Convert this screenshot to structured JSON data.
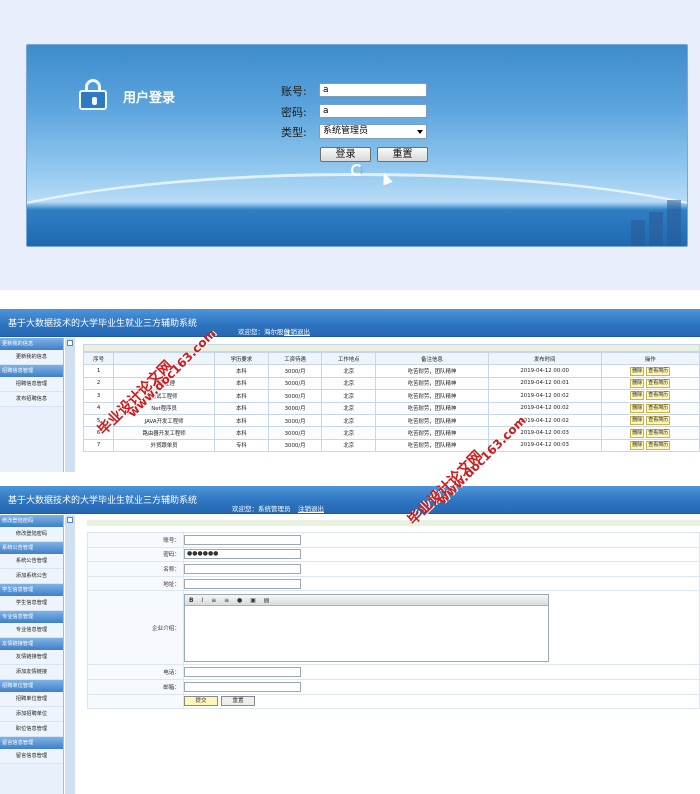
{
  "login": {
    "title": "用户登录",
    "account_label": "账号:",
    "account_value": "a",
    "password_label": "密码:",
    "password_value": "a",
    "type_label": "类型:",
    "type_value": "系统管理员",
    "login_button": "登录",
    "reset_button": "重置"
  },
  "app": {
    "title": "基于大数据技术的大学毕业生就业三方辅助系统",
    "welcome": "欢迎您：系统管理员",
    "welcome_partial": "欢迎您：海尔股份",
    "logout": "注销退出"
  },
  "company_view": {
    "sidebar": [
      {
        "type": "group",
        "label": "更新我的信息"
      },
      {
        "type": "item",
        "label": "更新我的信息"
      },
      {
        "type": "group",
        "label": "招聘信息管理"
      },
      {
        "type": "item",
        "label": "招聘信息管理"
      },
      {
        "type": "item",
        "label": "发布招聘信息"
      }
    ],
    "table": {
      "headers": [
        "序号",
        "",
        "学历要求",
        "工资待遇",
        "工作地点",
        "备注信息",
        "发布时间",
        "操作"
      ],
      "rows": [
        [
          "1",
          "",
          "本科",
          "3000/月",
          "北京",
          "吃苦耐劳，团队精神",
          "2019-04-12 00:00"
        ],
        [
          "2",
          "项目经理",
          "本科",
          "3000/月",
          "北京",
          "吃苦耐劳，团队精神",
          "2019-04-12 00:01"
        ],
        [
          "3",
          "测试工程师",
          "本科",
          "3000/月",
          "北京",
          "吃苦耐劳，团队精神",
          "2019-04-12 00:02"
        ],
        [
          "4",
          "Net程序员",
          "本科",
          "3000/月",
          "北京",
          "吃苦耐劳，团队精神",
          "2019-04-12 00:02"
        ],
        [
          "5",
          "JAVA开发工程师",
          "本科",
          "3000/月",
          "北京",
          "吃苦耐劳，团队精神",
          "2019-04-12 00:02"
        ],
        [
          "6",
          "路由器开发工程师",
          "本科",
          "3000/月",
          "北京",
          "吃苦耐劳，团队精神",
          "2019-04-12 00:03"
        ],
        [
          "7",
          "外贸跟单员",
          "专科",
          "3000/月",
          "北京",
          "吃苦耐劳，团队精神",
          "2019-04-12 00:03"
        ]
      ],
      "delete_label": "删除",
      "resume_label": "查看简历"
    }
  },
  "admin_view": {
    "sidebar": [
      {
        "type": "group",
        "label": "修改登陆密码"
      },
      {
        "type": "item",
        "label": "修改登陆密码"
      },
      {
        "type": "group",
        "label": "系统公告管理"
      },
      {
        "type": "item",
        "label": "系统公告管理"
      },
      {
        "type": "item",
        "label": "添加系统公告"
      },
      {
        "type": "group",
        "label": "学生信息管理"
      },
      {
        "type": "item",
        "label": "学生信息管理"
      },
      {
        "type": "group",
        "label": "专业信息管理"
      },
      {
        "type": "item",
        "label": "专业信息管理"
      },
      {
        "type": "group",
        "label": "友情链接管理"
      },
      {
        "type": "item",
        "label": "友情链接管理"
      },
      {
        "type": "item",
        "label": "添加友情链接"
      },
      {
        "type": "group",
        "label": "招聘单位管理"
      },
      {
        "type": "item",
        "label": "招聘单位管理"
      },
      {
        "type": "item",
        "label": "添加招聘单位"
      },
      {
        "type": "item",
        "label": "职位信息管理"
      },
      {
        "type": "group",
        "label": "留言信息管理"
      },
      {
        "type": "item",
        "label": "留言信息管理"
      }
    ],
    "form": {
      "account_label": "账号：",
      "password_label": "密码：",
      "password_value": "●●●●●●",
      "name_label": "名称：",
      "address_label": "地址：",
      "intro_label": "企业介绍：",
      "phone_label": "电话：",
      "email_label": "邮箱：",
      "submit_label": "提交",
      "reset_label": "重置"
    }
  },
  "watermarks": {
    "line1": "毕业设计论文网",
    "line2": "www.doc163.com"
  }
}
